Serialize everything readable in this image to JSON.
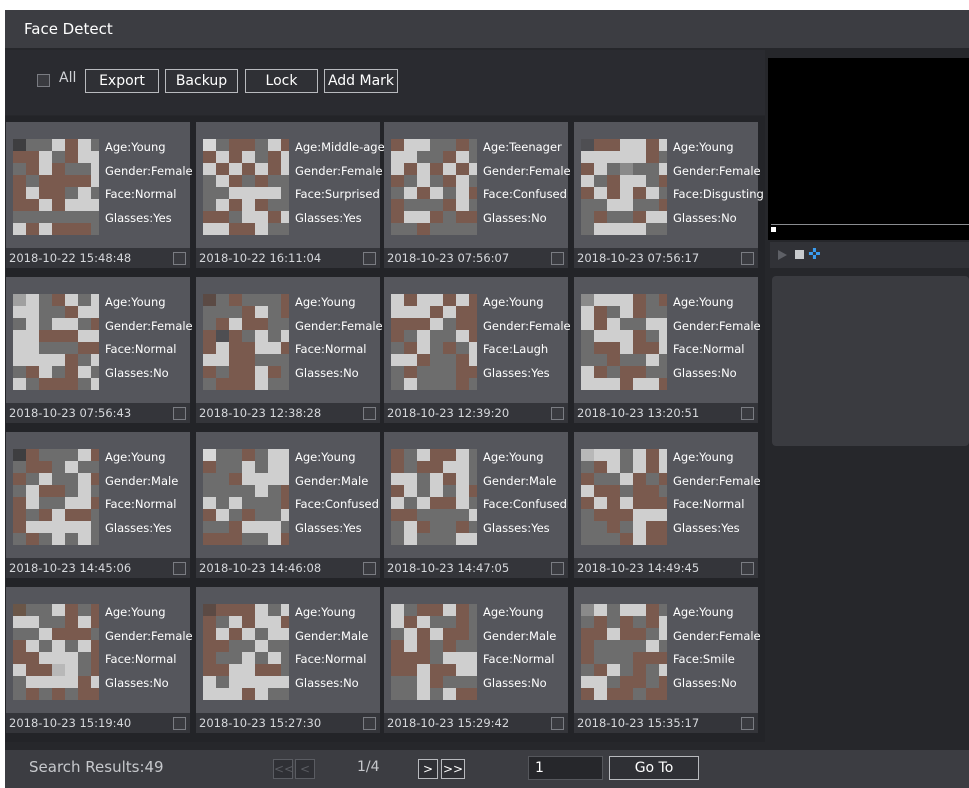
{
  "window": {
    "title": "Face Detect"
  },
  "toolbar": {
    "all_label": "All",
    "export_label": "Export",
    "backup_label": "Backup",
    "lock_label": "Lock",
    "add_mark_label": "Add Mark"
  },
  "results": [
    {
      "age": "Age:Young",
      "gender": "Gender:Female",
      "face": "Face:Normal",
      "glasses": "Glasses:Yes",
      "time": "2018-10-22 15:48:48"
    },
    {
      "age": "Age:Middle-aged",
      "gender": "Gender:Female",
      "face": "Face:Surprised",
      "glasses": "Glasses:Yes",
      "time": "2018-10-22 16:11:04"
    },
    {
      "age": "Age:Teenager",
      "gender": "Gender:Female",
      "face": "Face:Confused",
      "glasses": "Glasses:No",
      "time": "2018-10-23 07:56:07"
    },
    {
      "age": "Age:Young",
      "gender": "Gender:Female",
      "face": "Face:Disgusting",
      "glasses": "Glasses:No",
      "time": "2018-10-23 07:56:17"
    },
    {
      "age": "Age:Young",
      "gender": "Gender:Female",
      "face": "Face:Normal",
      "glasses": "Glasses:No",
      "time": "2018-10-23 07:56:43"
    },
    {
      "age": "Age:Young",
      "gender": "Gender:Female",
      "face": "Face:Normal",
      "glasses": "Glasses:No",
      "time": "2018-10-23 12:38:28"
    },
    {
      "age": "Age:Young",
      "gender": "Gender:Female",
      "face": "Face:Laugh",
      "glasses": "Glasses:Yes",
      "time": "2018-10-23 12:39:20"
    },
    {
      "age": "Age:Young",
      "gender": "Gender:Female",
      "face": "Face:Normal",
      "glasses": "Glasses:No",
      "time": "2018-10-23 13:20:51"
    },
    {
      "age": "Age:Young",
      "gender": "Gender:Male",
      "face": "Face:Normal",
      "glasses": "Glasses:Yes",
      "time": "2018-10-23 14:45:06"
    },
    {
      "age": "Age:Young",
      "gender": "Gender:Male",
      "face": "Face:Confused",
      "glasses": "Glasses:Yes",
      "time": "2018-10-23 14:46:08"
    },
    {
      "age": "Age:Young",
      "gender": "Gender:Male",
      "face": "Face:Confused",
      "glasses": "Glasses:Yes",
      "time": "2018-10-23 14:47:05"
    },
    {
      "age": "Age:Young",
      "gender": "Gender:Female",
      "face": "Face:Normal",
      "glasses": "Glasses:Yes",
      "time": "2018-10-23 14:49:45"
    },
    {
      "age": "Age:Young",
      "gender": "Gender:Female",
      "face": "Face:Normal",
      "glasses": "Glasses:No",
      "time": "2018-10-23 15:19:40"
    },
    {
      "age": "Age:Young",
      "gender": "Gender:Male",
      "face": "Face:Normal",
      "glasses": "Glasses:No",
      "time": "2018-10-23 15:27:30"
    },
    {
      "age": "Age:Young",
      "gender": "Gender:Male",
      "face": "Face:Normal",
      "glasses": "Glasses:No",
      "time": "2018-10-23 15:29:42"
    },
    {
      "age": "Age:Young",
      "gender": "Gender:Female",
      "face": "Face:Smile",
      "glasses": "Glasses:No",
      "time": "2018-10-23 15:35:17"
    }
  ],
  "status": {
    "search_results": "Search Results:49",
    "first_label": "<<",
    "prev_label": "<",
    "page_info": "1/4",
    "next_label": ">",
    "last_label": ">>",
    "page_input_value": "1",
    "goto_label": "Go To"
  },
  "icons": {
    "play": "play-icon",
    "stop": "stop-icon",
    "move": "move-icon"
  },
  "colors": {
    "accent": "#3a9cf0",
    "background": "#26272b"
  }
}
